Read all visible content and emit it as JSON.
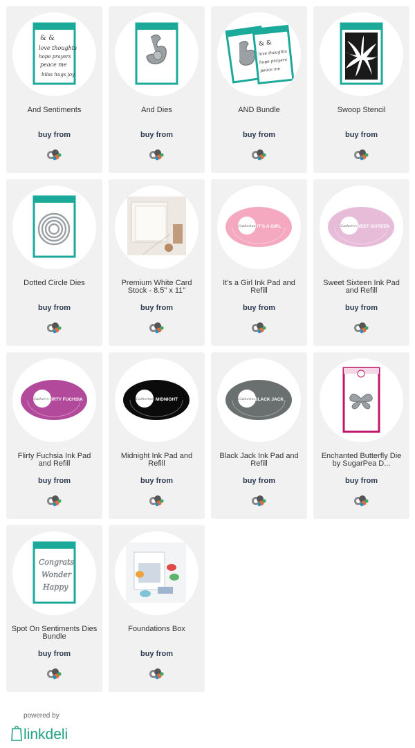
{
  "buy_label": "buy from",
  "products": [
    {
      "title": "And Sentiments",
      "art": "stamp-card",
      "accent": "#1ba99a"
    },
    {
      "title": "And Dies",
      "art": "die-card",
      "accent": "#1ba99a"
    },
    {
      "title": "AND Bundle",
      "art": "bundle-cards",
      "accent": "#1ba99a"
    },
    {
      "title": "Swoop Stencil",
      "art": "stencil",
      "accent": "#1ba99a"
    },
    {
      "title": "Dotted Circle Dies",
      "art": "circle-dies",
      "accent": "#1ba99a"
    },
    {
      "title": "Premium White Card Stock - 8.5\" x 11\"",
      "art": "cardstock-photo",
      "accent": "#d9cfc3"
    },
    {
      "title": "It's a Girl Ink Pad and Refill",
      "art": "ink-pad",
      "accent": "#f4a9c0",
      "pad_label": "IT'S A GIRL"
    },
    {
      "title": "Sweet Sixteen Ink Pad and Refill",
      "art": "ink-pad",
      "accent": "#e7bcd9",
      "pad_label": "SWEET SIXTEEN"
    },
    {
      "title": "Flirty Fuchsia Ink Pad and Refill",
      "art": "ink-pad",
      "accent": "#b3499a",
      "pad_label": "FLIRTY FUCHSIA"
    },
    {
      "title": "Midnight Ink Pad and Refill",
      "art": "ink-pad",
      "accent": "#0b0b0b",
      "pad_label": "MIDNIGHT"
    },
    {
      "title": "Black Jack Ink Pad and Refill",
      "art": "ink-pad",
      "accent": "#6a6f70",
      "pad_label": "BLACK JACK"
    },
    {
      "title": "Enchanted Butterfly Die by SugarPea D...",
      "art": "butterfly-die",
      "accent": "#c0166a"
    },
    {
      "title": "Spot On Sentiments Dies Bundle",
      "art": "sentiment-dies",
      "accent": "#1ba99a"
    },
    {
      "title": "Foundations Box",
      "art": "foundations-photo",
      "accent": "#9fb4cf"
    }
  ],
  "footer": {
    "powered_by": "powered by",
    "brand": "linkdeli",
    "brand_color": "#1fa383"
  }
}
